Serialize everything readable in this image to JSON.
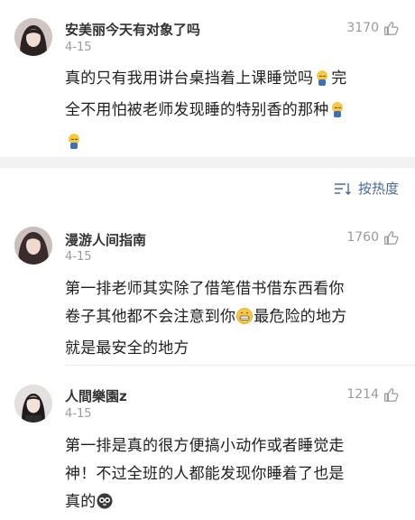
{
  "comments": [
    {
      "username": "安美丽今天有对象了吗",
      "date": "4-15",
      "likes": "3170",
      "lines": [
        "真的只有我用讲台桌挡着上课睡觉吗",
        "完",
        "全不用怕被老师发现睡的特别香的那种",
        ""
      ],
      "icon": "sleeping-emoji-icon"
    },
    {
      "username": "漫游人间指南",
      "date": "4-15",
      "likes": "1760",
      "lines": [
        "第一排老师其实除了借笔借书借东西看你",
        "卷子其他都不会注意到你",
        "最危险的地方",
        "就是最安全的地方"
      ],
      "icon": "grin-emoji-icon"
    },
    {
      "username": "人間樂園z",
      "date": "4-15",
      "likes": "1214",
      "lines": [
        "第一排是真的很方便搞小动作或者睡觉走",
        "神！不过全班的人都能发现你睡着了也是",
        "真的"
      ],
      "icon": "panda-emoji-icon"
    }
  ],
  "sort": {
    "label": "按热度",
    "icon": "sort-lines-icon"
  },
  "colors": {
    "link": "#4a6a96",
    "muted": "#9a9a9a",
    "band": "#f2f2f2"
  }
}
